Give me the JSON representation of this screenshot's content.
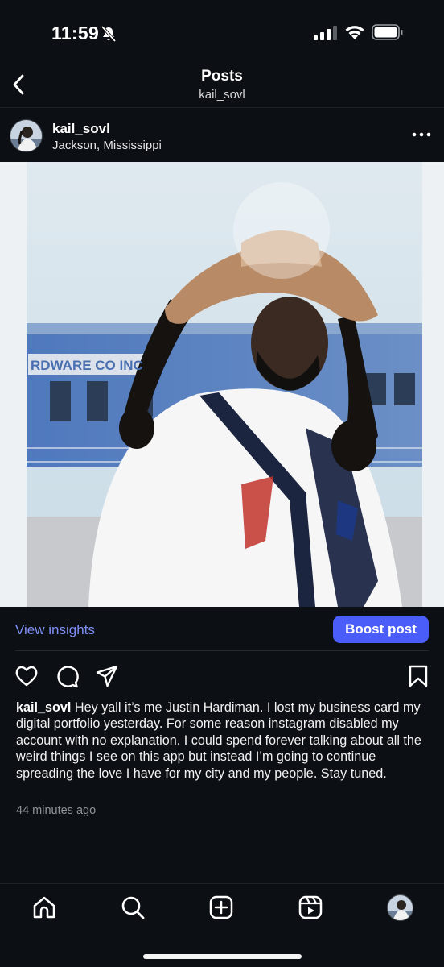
{
  "status_bar": {
    "time": "11:59",
    "icons": [
      "bell-muted-icon",
      "signal-icon",
      "wifi-icon",
      "battery-icon"
    ]
  },
  "header": {
    "title": "Posts",
    "subtitle": "kail_sovl",
    "back_icon": "chevron-left-icon"
  },
  "post": {
    "username": "kail_sovl",
    "location": "Jackson, Mississippi",
    "more_icon": "more-horizontal-icon",
    "photo_sign_text": "RDWARE CO INC"
  },
  "insights": {
    "view_label": "View insights",
    "boost_label": "Boost post",
    "accent": "#4a5df9",
    "link_color": "#7f8ff4"
  },
  "actions": [
    "heart-icon",
    "comment-icon",
    "share-icon",
    "bookmark-icon"
  ],
  "caption": {
    "username": "kail_sovl",
    "text": "Hey yall it’s me Justin Hardiman. I lost my business card my digital portfolio yesterday. For some reason instagram disabled my account with no explanation. I could spend forever talking about all the weird things I see on this app but instead I’m going to continue spreading the love I have for my city and my people. Stay tuned.",
    "timestamp": "44 minutes ago"
  },
  "bottom_nav": [
    "home-icon",
    "search-icon",
    "create-icon",
    "reels-icon",
    "profile-avatar"
  ],
  "colors": {
    "background": "#0c1014",
    "text": "#f5f5f5",
    "muted": "#8e9399"
  }
}
